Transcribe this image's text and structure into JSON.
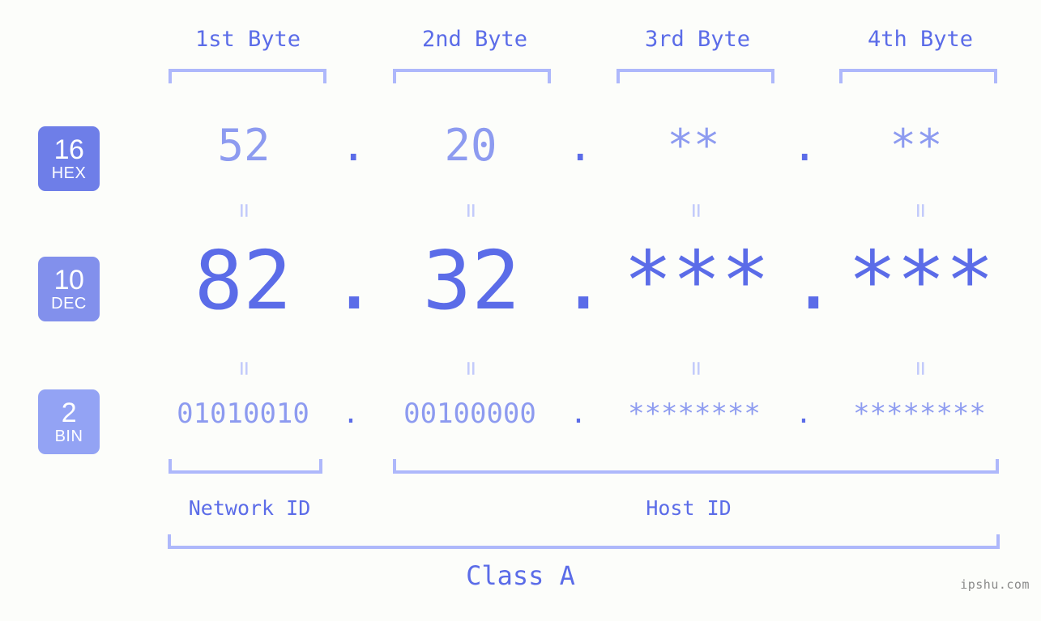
{
  "page": {
    "title": "IP address byte breakdown",
    "background_color": "#fcfdfa",
    "accent_color": "#5b6ce8",
    "muted_accent_color": "#8d9bf0",
    "bracket_color": "#aeb8fb",
    "watermark": "ipshu.com"
  },
  "byte_headers": [
    {
      "label": "1st Byte"
    },
    {
      "label": "2nd Byte"
    },
    {
      "label": "3rd Byte"
    },
    {
      "label": "4th Byte"
    }
  ],
  "radix_badges": [
    {
      "number": "16",
      "name": "HEX",
      "color": "#6e7ee8"
    },
    {
      "number": "10",
      "name": "DEC",
      "color": "#8290ec"
    },
    {
      "number": "2",
      "name": "BIN",
      "color": "#93a3f4"
    }
  ],
  "rows": {
    "hex": {
      "radix": "16",
      "radix_name": "HEX",
      "values": [
        "52",
        "20",
        "**",
        "**"
      ],
      "separator": "."
    },
    "dec": {
      "radix": "10",
      "radix_name": "DEC",
      "values": [
        "82",
        "32",
        "***",
        "***"
      ],
      "separator": "."
    },
    "bin": {
      "radix": "2",
      "radix_name": "BIN",
      "values": [
        "01010010",
        "00100000",
        "********",
        "********"
      ],
      "separator": "."
    }
  },
  "equals_connectors": {
    "glyph": "=",
    "count_per_row": 4
  },
  "segments": {
    "network_id": {
      "label": "Network ID"
    },
    "host_id": {
      "label": "Host ID"
    },
    "class": {
      "label": "Class A"
    }
  }
}
